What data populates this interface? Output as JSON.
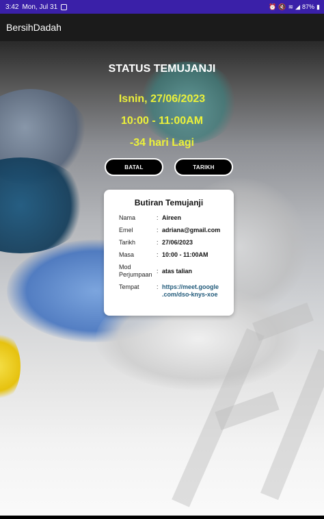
{
  "status_bar": {
    "time": "3:42",
    "date": "Mon, Jul 31",
    "battery": "87%"
  },
  "app": {
    "title": "BersihDadah"
  },
  "appointment": {
    "heading": "STATUS TEMUJANJI",
    "date": "Isnin, 27/06/2023",
    "time": "10:00 - 11:00AM",
    "countdown": "-34 hari Lagi"
  },
  "actions": {
    "cancel_label": "BATAL",
    "date_label": "TARIKH"
  },
  "details": {
    "title": "Butiran Temujanji",
    "separator": ":",
    "rows": [
      {
        "label": "Nama",
        "value": "Aireen"
      },
      {
        "label": "Emel",
        "value": "adriana@gmail.com"
      },
      {
        "label": "Tarikh",
        "value": "27/06/2023"
      },
      {
        "label": "Masa",
        "value": "10:00 - 11:00AM"
      },
      {
        "label": "Mod\nPerjumpaan",
        "value": "atas talian"
      },
      {
        "label": "Tempat",
        "value": "https://meet.google\n.com/dso-knys-xoe"
      }
    ]
  },
  "colors": {
    "status_bar": "#3a20a8",
    "app_bar": "#1b1b1b",
    "highlight": "#ecf13a",
    "link": "#215a7a"
  }
}
